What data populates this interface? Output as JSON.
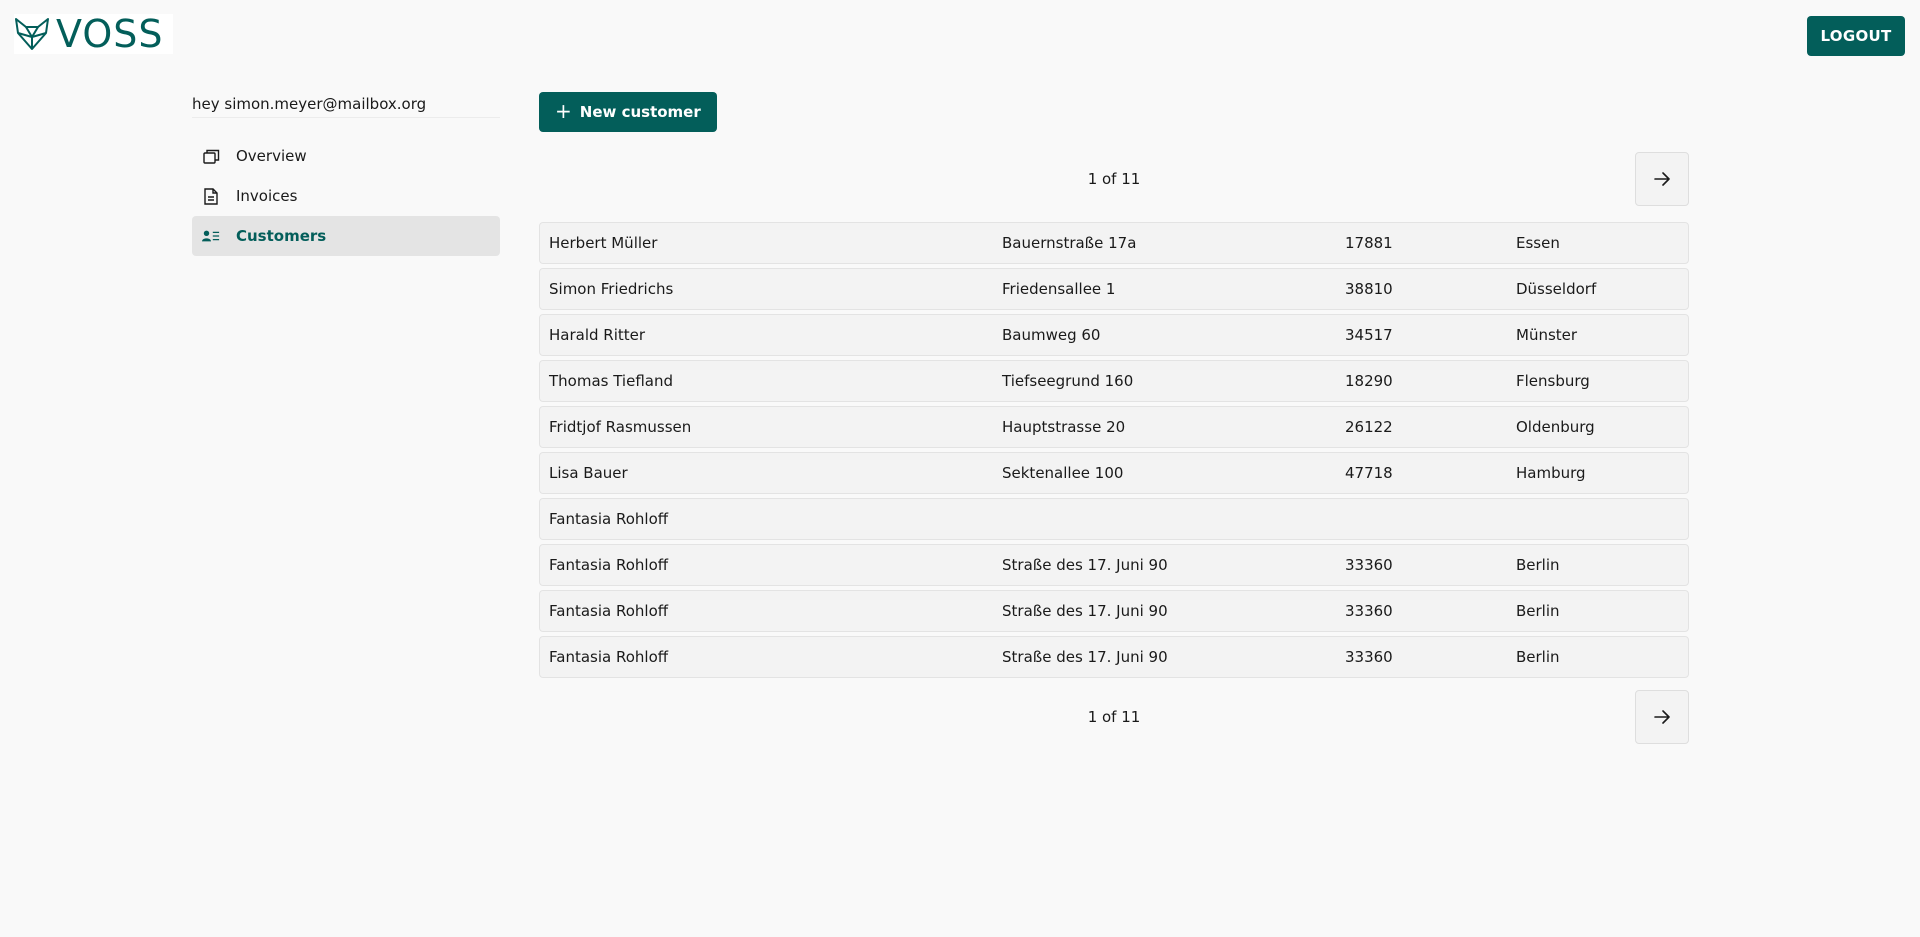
{
  "app": {
    "logo_text": "VOSS",
    "logout_label": "LOGOUT"
  },
  "sidebar": {
    "greeting": "hey simon.meyer@mailbox.org",
    "items": [
      {
        "label": "Overview",
        "icon": "overview-icon"
      },
      {
        "label": "Invoices",
        "icon": "document-icon"
      },
      {
        "label": "Customers",
        "icon": "contact-list-icon",
        "active": true
      }
    ]
  },
  "main": {
    "new_button_label": "New customer",
    "pagination": {
      "text": "1 of 11"
    },
    "customers": [
      {
        "name": "Herbert Müller",
        "street": "Bauernstraße 17a",
        "zip": "17881",
        "city": "Essen"
      },
      {
        "name": "Simon Friedrichs",
        "street": "Friedensallee 1",
        "zip": "38810",
        "city": "Düsseldorf"
      },
      {
        "name": "Harald Ritter",
        "street": "Baumweg 60",
        "zip": "34517",
        "city": "Münster"
      },
      {
        "name": "Thomas Tiefland",
        "street": "Tiefseegrund 160",
        "zip": "18290",
        "city": "Flensburg"
      },
      {
        "name": "Fridtjof Rasmussen",
        "street": "Hauptstrasse 20",
        "zip": "26122",
        "city": "Oldenburg"
      },
      {
        "name": "Lisa Bauer",
        "street": "Sektenallee 100",
        "zip": "47718",
        "city": "Hamburg"
      },
      {
        "name": "Fantasia Rohloff",
        "street": "",
        "zip": "",
        "city": ""
      },
      {
        "name": "Fantasia Rohloff",
        "street": "Straße des 17. Juni 90",
        "zip": "33360",
        "city": "Berlin"
      },
      {
        "name": "Fantasia Rohloff",
        "street": "Straße des 17. Juni 90",
        "zip": "33360",
        "city": "Berlin"
      },
      {
        "name": "Fantasia Rohloff",
        "street": "Straße des 17. Juni 90",
        "zip": "33360",
        "city": "Berlin"
      }
    ]
  },
  "colors": {
    "brand": "#035e5a",
    "background": "#f9f9f9",
    "row_background": "#f3f3f3",
    "active_nav_background": "#e4e4e4"
  }
}
